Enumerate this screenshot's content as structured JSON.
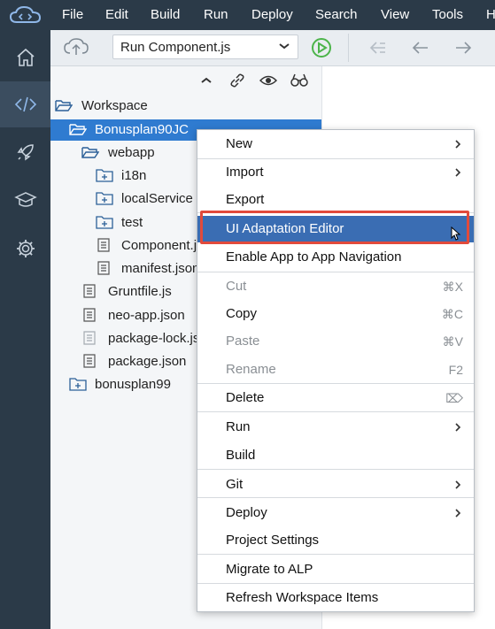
{
  "menubar": {
    "items": [
      "File",
      "Edit",
      "Build",
      "Run",
      "Deploy",
      "Search",
      "View",
      "Tools",
      "H"
    ]
  },
  "leftnav": {
    "items": [
      "home-icon",
      "code-icon",
      "rocket-icon",
      "graduation-cap-icon",
      "gear-icon"
    ]
  },
  "toolbar": {
    "run_config": "Run Component.js"
  },
  "workspace": {
    "tree": [
      {
        "label": "Workspace",
        "icon": "folder-open-icon"
      },
      {
        "label": "Bonusplan90JC",
        "icon": "folder-open-icon",
        "selected": true
      },
      {
        "label": "webapp",
        "icon": "folder-open-icon"
      },
      {
        "label": "i18n",
        "icon": "folder-plus-icon"
      },
      {
        "label": "localService",
        "icon": "folder-plus-icon"
      },
      {
        "label": "test",
        "icon": "folder-plus-icon"
      },
      {
        "label": "Component.js",
        "icon": "file-icon"
      },
      {
        "label": "manifest.json",
        "icon": "file-icon"
      },
      {
        "label": "Gruntfile.js",
        "icon": "file-icon"
      },
      {
        "label": "neo-app.json",
        "icon": "file-icon"
      },
      {
        "label": "package-lock.json",
        "icon": "file-icon"
      },
      {
        "label": "package.json",
        "icon": "file-icon"
      },
      {
        "label": "bonusplan99",
        "icon": "folder-plus-icon"
      }
    ]
  },
  "context_menu": {
    "items": [
      {
        "label": "New",
        "submenu": true
      },
      {
        "label": "Import",
        "submenu": true
      },
      {
        "label": "Export"
      },
      {
        "label": "UI Adaptation Editor",
        "highlighted": true
      },
      {
        "label": "Enable App to App Navigation"
      },
      {
        "label": "Cut",
        "shortcut": "⌘X",
        "disabled": true
      },
      {
        "label": "Copy",
        "shortcut": "⌘C"
      },
      {
        "label": "Paste",
        "shortcut": "⌘V",
        "disabled": true
      },
      {
        "label": "Rename",
        "shortcut": "F2",
        "disabled": true
      },
      {
        "label": "Delete",
        "shortcut": "⌦"
      },
      {
        "label": "Run",
        "submenu": true
      },
      {
        "label": "Build"
      },
      {
        "label": "Git",
        "submenu": true
      },
      {
        "label": "Deploy",
        "submenu": true
      },
      {
        "label": "Project Settings"
      },
      {
        "label": "Migrate to ALP"
      },
      {
        "label": "Refresh Workspace Items"
      }
    ]
  },
  "colors": {
    "sidebar_bg": "#2b3a48",
    "selection": "#2f7bd0",
    "highlight": "#3a6db3",
    "highlight_border": "#e14a3b",
    "run_green": "#4cb44a"
  }
}
